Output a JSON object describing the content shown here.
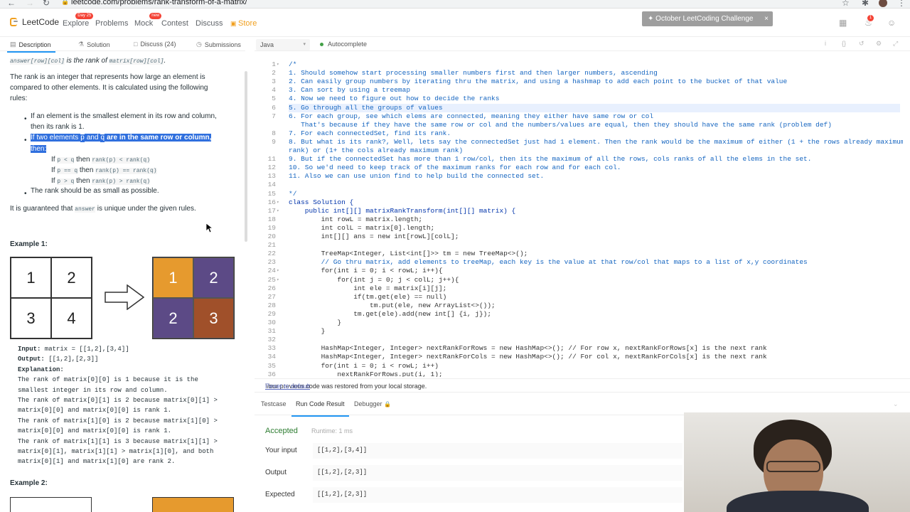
{
  "browser": {
    "url": "leetcode.com/problems/rank-transform-of-a-matrix/"
  },
  "nav": {
    "logo": "LeetCode",
    "links": [
      {
        "label": "Explore",
        "badge": "Day 25"
      },
      {
        "label": "Problems",
        "badge": ""
      },
      {
        "label": "Mock",
        "badge": "new"
      },
      {
        "label": "Contest",
        "badge": ""
      },
      {
        "label": "Discuss",
        "badge": ""
      },
      {
        "label": "Store",
        "badge": ""
      }
    ],
    "challenge": "October LeetCoding Challenge",
    "notifications": "1"
  },
  "problem_tabs": {
    "description": "Description",
    "solution": "Solution",
    "discuss": "Discuss (24)",
    "submissions": "Submissions"
  },
  "description": {
    "l0a": "answer[row][col]",
    "l0b": " is the rank of ",
    "l0c": "matrix[row][col]",
    "l0d": ".",
    "p1": "The rank is an integer that represents how large an element is compared to other elements. It is calculated using the following rules:",
    "b1": "If an element is the smallest element in its row and column, then its rank is 1.",
    "b2a": "If two elements ",
    "b2b": "p",
    "b2c": " and ",
    "b2d": "q",
    "b2e": " are in the same row or column,",
    "b2f": "then:",
    "s1a": "If ",
    "s1b": "p < q",
    "s1c": " then ",
    "s1d": "rank(p) < rank(q)",
    "s2a": "If ",
    "s2b": "p == q",
    "s2c": " then ",
    "s2d": "rank(p) == rank(q)",
    "s3a": "If ",
    "s3b": "p > q",
    "s3c": " then ",
    "s3d": "rank(p) > rank(q)",
    "b3": "The rank should be as small as possible.",
    "p2a": "It is guaranteed that ",
    "p2b": "answer",
    "p2c": " is unique under the given rules.",
    "ex1_title": "Example 1:",
    "ex1_grid_in": [
      "1",
      "2",
      "3",
      "4"
    ],
    "ex1_grid_out": [
      "1",
      "2",
      "2",
      "3"
    ],
    "ex1_colors": [
      "#e69a2e",
      "#5c4a86",
      "#5c4a86",
      "#a0502a"
    ],
    "input_label": "Input:",
    "input_val": " matrix = [[1,2],[3,4]]",
    "output_label": "Output:",
    "output_val": " [[1,2],[2,3]]",
    "expl_label": "Explanation:",
    "expl_lines": [
      "The rank of matrix[0][0] is 1 because it is the",
      "smallest integer in its row and column.",
      "The rank of matrix[0][1] is 2 because matrix[0][1] >",
      "matrix[0][0] and matrix[0][0] is rank 1.",
      "The rank of matrix[1][0] is 2 because matrix[1][0] >",
      "matrix[0][0] and matrix[0][0] is rank 1.",
      "The rank of matrix[1][1] is 3 because matrix[1][1] >",
      "matrix[0][1], matrix[1][1] > matrix[1][0], and both",
      "matrix[0][1] and matrix[1][0] are rank 2."
    ],
    "ex2_title": "Example 2:"
  },
  "editor": {
    "language": "Java",
    "autocomplete": "Autocomplete",
    "highlight_line": 6,
    "lines": [
      {
        "n": "1",
        "f": "▾",
        "t": "/*",
        "c": "cm"
      },
      {
        "n": "2",
        "f": "",
        "t": "1. Should somehow start processing smaller numbers first and then larger numbers, ascending",
        "c": "cm"
      },
      {
        "n": "3",
        "f": "",
        "t": "2. Can easily group numbers by iterating thru the matrix, and using a hashmap to add each point to the bucket of that value",
        "c": "cm"
      },
      {
        "n": "4",
        "f": "",
        "t": "3. Can sort by using a treemap",
        "c": "cm"
      },
      {
        "n": "5",
        "f": "",
        "t": "4. Now we need to figure out how to decide the ranks",
        "c": "cm"
      },
      {
        "n": "6",
        "f": "",
        "t": "5. Go through all the groups of values",
        "c": "cm"
      },
      {
        "n": "7",
        "f": "",
        "t": "6. For each group, see which elems are connected, meaning they either have same row or col",
        "c": "cm"
      },
      {
        "n": "",
        "f": "",
        "t": "   That's because if they have the same row or col and the numbers/values are equal, then they should have the same rank (problem def)",
        "c": "cm"
      },
      {
        "n": "8",
        "f": "",
        "t": "7. For each connectedSet, find its rank.",
        "c": "cm"
      },
      {
        "n": "9",
        "f": "",
        "t": "8. But what is its rank?, Well, lets say the connectedSet just had 1 element. Then the rank would be the maximum of either (1 + the rows already maximum",
        "c": "cm"
      },
      {
        "n": "",
        "f": "",
        "t": "rank) or (1+ the cols already maximum rank)",
        "c": "cm"
      },
      {
        "n": "11",
        "f": "",
        "t": "9. But if the connectedSet has more than 1 row/col, then its the maximum of all the rows, cols ranks of all the elems in the set.",
        "c": "cm"
      },
      {
        "n": "12",
        "f": "",
        "t": "10. So we'd need to keep track of the maximum ranks for each row and for each col.",
        "c": "cm"
      },
      {
        "n": "13",
        "f": "",
        "t": "11. Also we can use union find to help build the connected set.",
        "c": "cm"
      },
      {
        "n": "14",
        "f": "",
        "t": "",
        "c": "cm"
      },
      {
        "n": "15",
        "f": "",
        "t": "*/",
        "c": "cm"
      },
      {
        "n": "16",
        "f": "▾",
        "t": "class Solution {",
        "c": "kw"
      },
      {
        "n": "17",
        "f": "▾",
        "t": "    public int[][] matrixRankTransform(int[][] matrix) {",
        "c": "kw"
      },
      {
        "n": "18",
        "f": "",
        "t": "        int rowL = matrix.length;",
        "c": ""
      },
      {
        "n": "19",
        "f": "",
        "t": "        int colL = matrix[0].length;",
        "c": ""
      },
      {
        "n": "20",
        "f": "",
        "t": "        int[][] ans = new int[rowL][colL];",
        "c": ""
      },
      {
        "n": "21",
        "f": "",
        "t": "",
        "c": ""
      },
      {
        "n": "22",
        "f": "",
        "t": "        TreeMap<Integer, List<int[]>> tm = new TreeMap<>();",
        "c": ""
      },
      {
        "n": "23",
        "f": "",
        "t": "        // Go thru matrix, add elements to treeMap, each key is the value at that row/col that maps to a list of x,y coordinates",
        "c": "cm"
      },
      {
        "n": "24",
        "f": "▾",
        "t": "        for(int i = 0; i < rowL; i++){",
        "c": ""
      },
      {
        "n": "25",
        "f": "▾",
        "t": "            for(int j = 0; j < colL; j++){",
        "c": ""
      },
      {
        "n": "26",
        "f": "",
        "t": "                int ele = matrix[i][j];",
        "c": ""
      },
      {
        "n": "27",
        "f": "",
        "t": "                if(tm.get(ele) == null)",
        "c": ""
      },
      {
        "n": "28",
        "f": "",
        "t": "                    tm.put(ele, new ArrayList<>());",
        "c": ""
      },
      {
        "n": "29",
        "f": "",
        "t": "                tm.get(ele).add(new int[] {i, j});",
        "c": ""
      },
      {
        "n": "30",
        "f": "",
        "t": "            }",
        "c": ""
      },
      {
        "n": "31",
        "f": "",
        "t": "        }",
        "c": ""
      },
      {
        "n": "32",
        "f": "",
        "t": "",
        "c": ""
      },
      {
        "n": "33",
        "f": "",
        "t": "        HashMap<Integer, Integer> nextRankForRows = new HashMap<>(); // For row x, nextRankForRows[x] is the next rank",
        "c": ""
      },
      {
        "n": "34",
        "f": "",
        "t": "        HashMap<Integer, Integer> nextRankForCols = new HashMap<>(); // For col x, nextRankForCols[x] is the next rank",
        "c": ""
      },
      {
        "n": "35",
        "f": "",
        "t": "        for(int i = 0; i < rowL; i++)",
        "c": ""
      },
      {
        "n": "36",
        "f": "",
        "t": "            nextRankForRows.put(i, 1);",
        "c": ""
      }
    ]
  },
  "console": {
    "restore_msg": "Your previous code was restored from your local storage.",
    "reset_label": "Reset to default",
    "tabs": [
      "Testcase",
      "Run Code Result",
      "Debugger"
    ],
    "status": "Accepted",
    "runtime": "Runtime: 1 ms",
    "your_input_label": "Your input",
    "your_input": "[[1,2],[3,4]]",
    "output_label": "Output",
    "output": "[[1,2],[2,3]]",
    "expected_label": "Expected",
    "expected": "[[1,2],[2,3]]"
  }
}
